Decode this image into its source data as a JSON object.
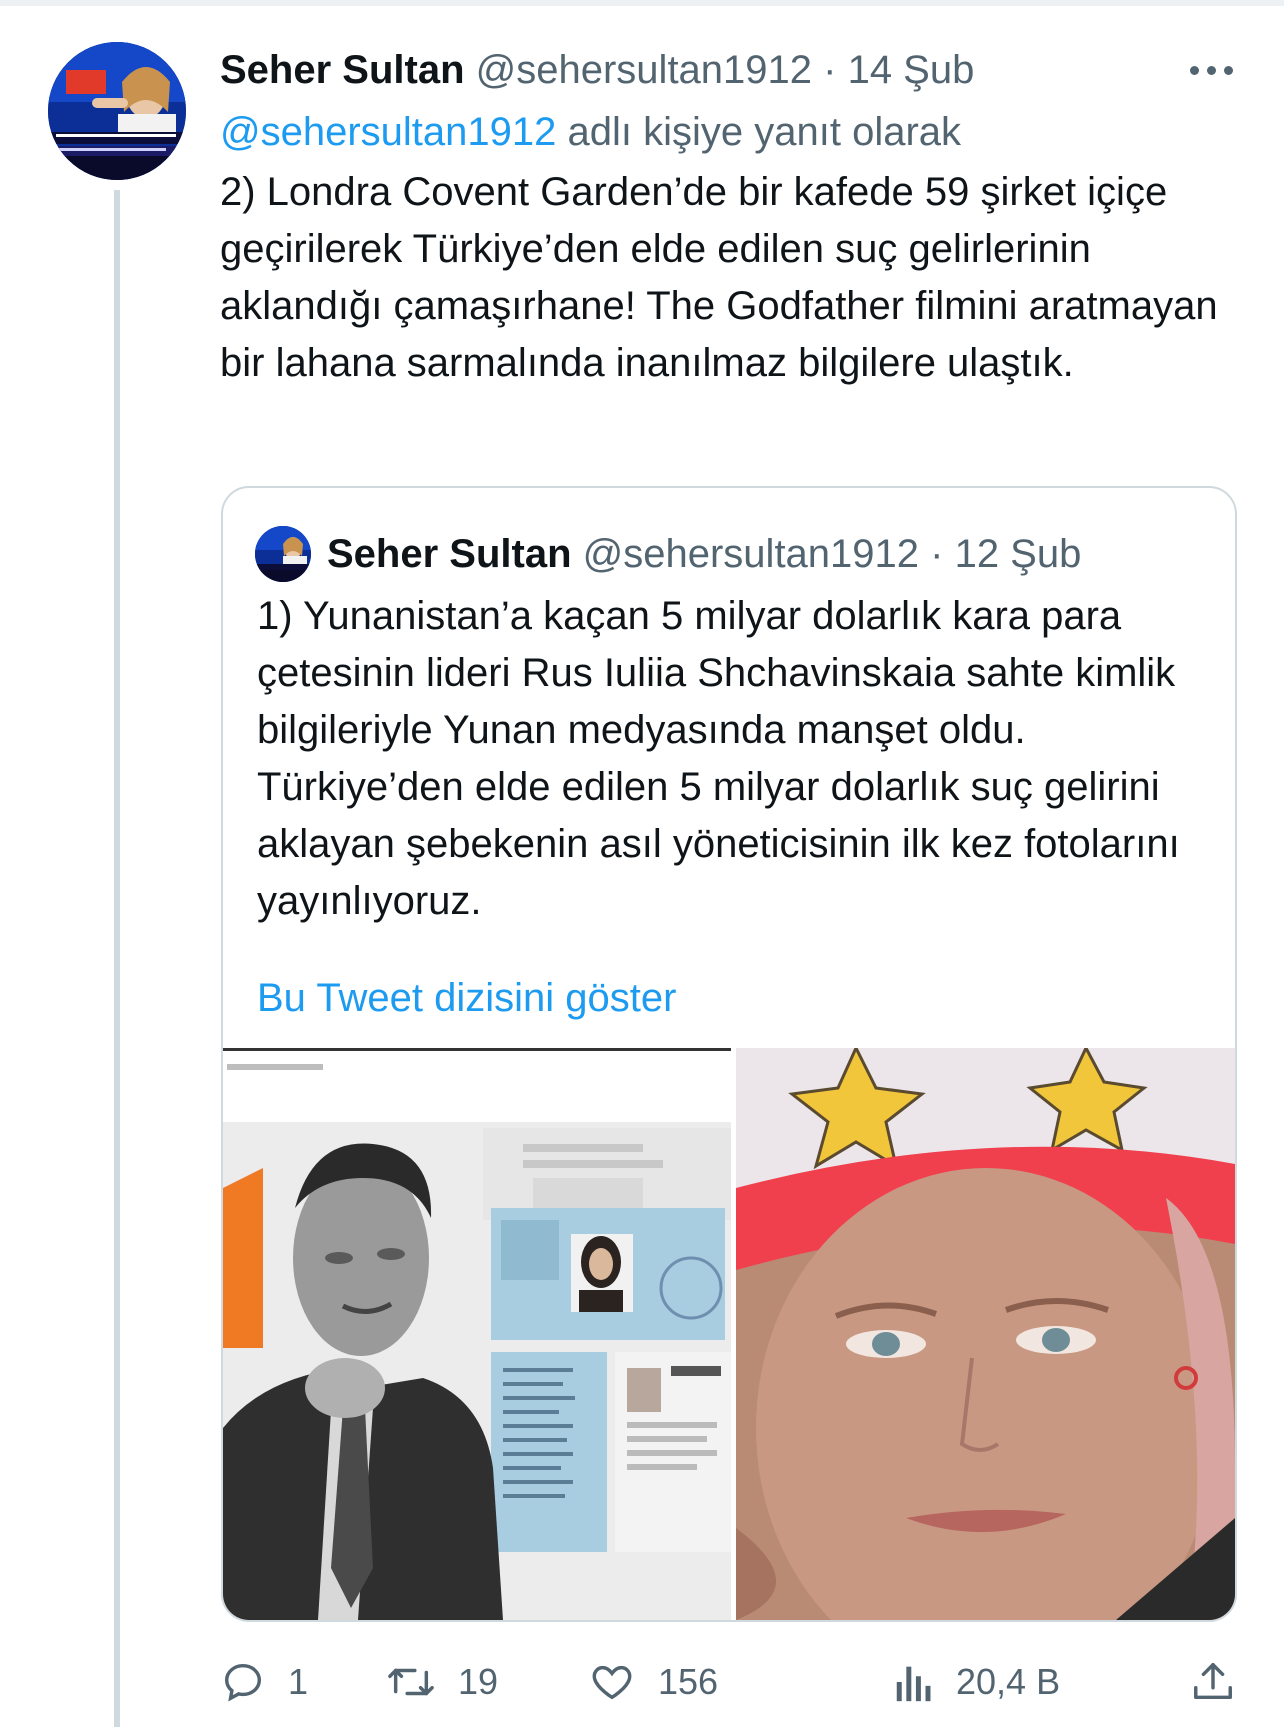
{
  "tweet": {
    "author_name": "Seher Sultan",
    "author_handle": "@sehersultan1912",
    "separator": " · ",
    "date": "14 Şub",
    "reply_handle": "@sehersultan1912",
    "reply_suffix": " adlı kişiye yanıt olarak",
    "text": "2) Londra Covent Garden’de bir kafede 59 şirket içiçe geçirilerek Türkiye’den elde edilen suç gelirlerinin aklandığı çamaşırhane! The Godfather filmini aratmayan bir lahana sarmalında inanılmaz bilgilere ulaştık."
  },
  "quoted_tweet": {
    "author_name": "Seher Sultan",
    "author_handle": "@sehersultan1912",
    "separator": " · ",
    "date": "12 Şub",
    "text": "1) Yunanistan’a kaçan 5 milyar dolarlık kara para çetesinin lideri Rus Iuliia Shchavinskaia sahte kimlik bilgileriyle Yunan medyasında manşet oldu. Türkiye’den elde edilen 5 milyar dolarlık suç gelirini aklayan şebekenin asıl yöneticisinin ilk kez fotolarını yayınlıyoruz.",
    "show_thread_label": "Bu Tweet dizisini göster"
  },
  "actions": {
    "reply_count": "1",
    "retweet_count": "19",
    "like_count": "156",
    "views_count": "20,4 B"
  },
  "colors": {
    "accent": "#1d9bf0",
    "muted": "#536471",
    "text": "#0f1419",
    "border": "#cfd9de"
  },
  "icons": [
    "more-icon",
    "reply-icon",
    "retweet-icon",
    "like-icon",
    "views-icon",
    "share-icon"
  ]
}
